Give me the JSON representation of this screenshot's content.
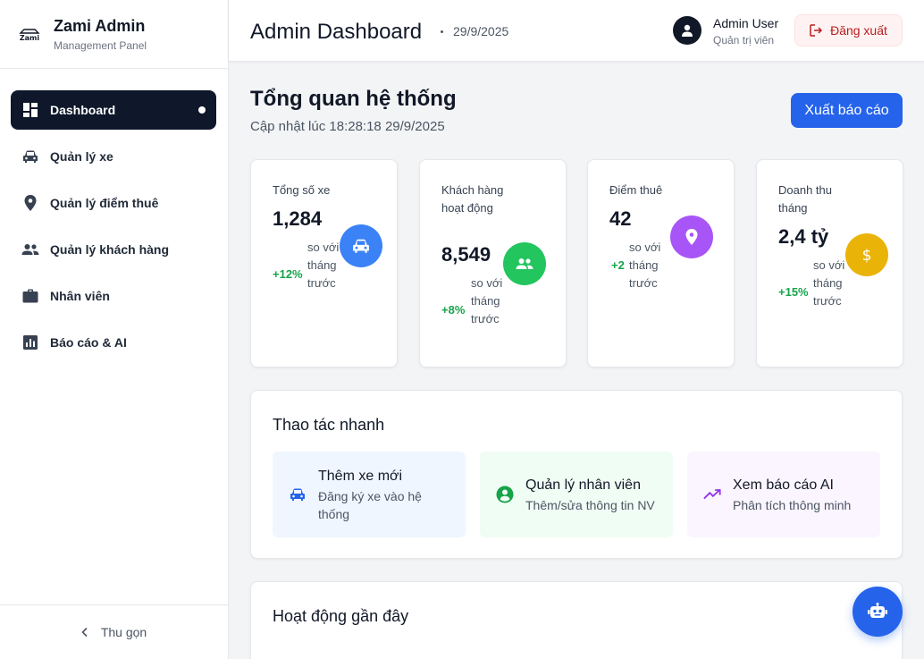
{
  "brand": {
    "title": "Zami Admin",
    "subtitle": "Management Panel",
    "logo_text": "Zami"
  },
  "sidebar": {
    "items": [
      {
        "label": "Dashboard",
        "icon": "dashboard-icon",
        "active": true
      },
      {
        "label": "Quản lý xe",
        "icon": "car-icon"
      },
      {
        "label": "Quản lý điểm thuê",
        "icon": "location-pin-icon"
      },
      {
        "label": "Quản lý khách hàng",
        "icon": "people-icon"
      },
      {
        "label": "Nhân viên",
        "icon": "briefcase-icon"
      },
      {
        "label": "Báo cáo & AI",
        "icon": "bar-chart-icon"
      }
    ],
    "collapse_label": "Thu gọn"
  },
  "header": {
    "title": "Admin Dashboard",
    "date": "29/9/2025",
    "user_name": "Admin User",
    "user_role": "Quản trị viên",
    "logout_label": "Đăng xuất"
  },
  "main": {
    "title": "Tổng quan hệ thống",
    "updated": "Cập nhật lúc 18:28:18 29/9/2025",
    "export_label": "Xuất báo cáo"
  },
  "stats": [
    {
      "label": "Tổng số xe",
      "value": "1,284",
      "change": "+12%",
      "note": "so với tháng trước",
      "icon": "car-icon",
      "color": "#3b82f6"
    },
    {
      "label": "Khách hàng hoạt động",
      "value": "8,549",
      "change": "+8%",
      "note": "so với tháng trước",
      "icon": "people-icon",
      "color": "#22c55e"
    },
    {
      "label": "Điểm thuê",
      "value": "42",
      "change": "+2",
      "note": "so với tháng trước",
      "icon": "location-pin-icon",
      "color": "#a855f7"
    },
    {
      "label": "Doanh thu tháng",
      "value": "2,4 tỷ",
      "change": "+15%",
      "note": "so với tháng trước",
      "icon": "dollar-icon",
      "color": "#eab308"
    }
  ],
  "quick_actions": {
    "title": "Thao tác nhanh",
    "items": [
      {
        "title": "Thêm xe mới",
        "desc": "Đăng ký xe vào hệ thống",
        "icon": "car-icon",
        "bg": "#eff6ff",
        "color": "#2563eb"
      },
      {
        "title": "Quản lý nhân viên",
        "desc": "Thêm/sửa thông tin NV",
        "icon": "user-circle-icon",
        "bg": "#f0fdf4",
        "color": "#16a34a"
      },
      {
        "title": "Xem báo cáo AI",
        "desc": "Phân tích thông minh",
        "icon": "trending-up-icon",
        "bg": "#faf5ff",
        "color": "#9333ea"
      }
    ]
  },
  "recent": {
    "title": "Hoạt động gần đây"
  },
  "fab": {
    "icon": "robot-icon"
  }
}
